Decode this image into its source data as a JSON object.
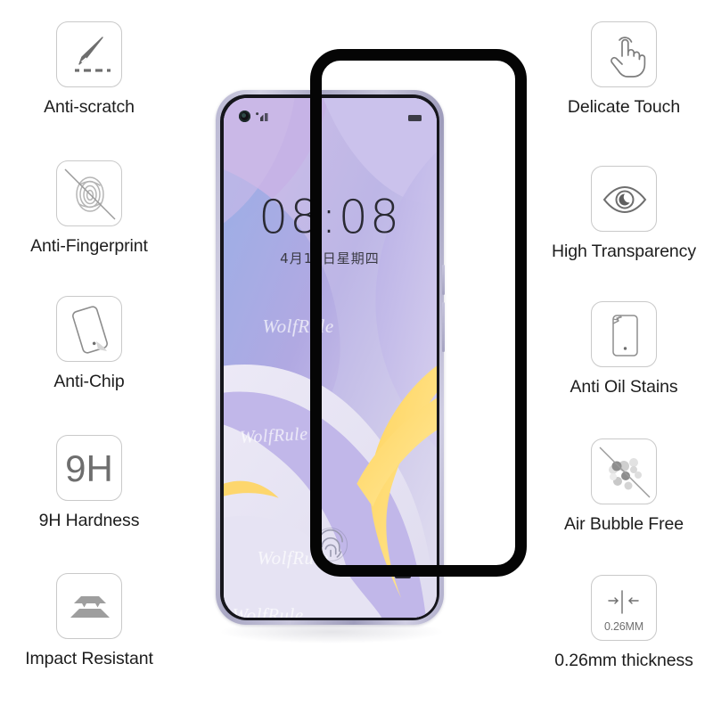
{
  "page": {
    "background_color": "#ffffff",
    "watermark_text": "WolfRule",
    "label_color": "#1d1d1d",
    "icon_border_color": "#c9c9c9"
  },
  "features_left": [
    {
      "id": "anti-scratch",
      "icon": "scalpel-scratch-icon",
      "label": "Anti-scratch"
    },
    {
      "id": "anti-fingerprint",
      "icon": "fingerprint-slash-icon",
      "label": "Anti-Fingerprint"
    },
    {
      "id": "anti-chip",
      "icon": "phone-tilted-icon",
      "label": "Anti-Chip"
    },
    {
      "id": "9h-hardness",
      "icon": "9h-text-icon",
      "label": "9H Hardness",
      "icon_text": "9H"
    },
    {
      "id": "impact-resistant",
      "icon": "layered-plates-icon",
      "label": "Impact Resistant"
    }
  ],
  "features_right": [
    {
      "id": "delicate-touch",
      "icon": "tap-hand-icon",
      "label": "Delicate Touch"
    },
    {
      "id": "high-transparency",
      "icon": "eye-icon",
      "label": "High Transparency"
    },
    {
      "id": "anti-oil-stains",
      "icon": "phone-crack-icon",
      "label": "Anti Oil Stains"
    },
    {
      "id": "air-bubble-free",
      "icon": "bubbles-slash-icon",
      "label": "Air Bubble Free"
    },
    {
      "id": "thickness",
      "icon": "caliper-arrows-icon",
      "label": "0.26mm thickness",
      "icon_text": "0.26MM"
    }
  ],
  "phone": {
    "status_bar": {
      "camera": "punch-hole-camera",
      "signal": "signal-bars-icon",
      "battery": "battery-icon"
    },
    "lockscreen": {
      "time": "08:08",
      "date": "4月13日星期四"
    },
    "fingerprint_sensor": "fingerprint-icon",
    "camera_shortcut": "camera-icon",
    "watermarks": [
      "WolfRule",
      "WolfRule",
      "WolfRule",
      "WolfRule"
    ]
  },
  "glass_overlay": {
    "name": "tempered-glass-protector",
    "border_color": "#050505"
  }
}
